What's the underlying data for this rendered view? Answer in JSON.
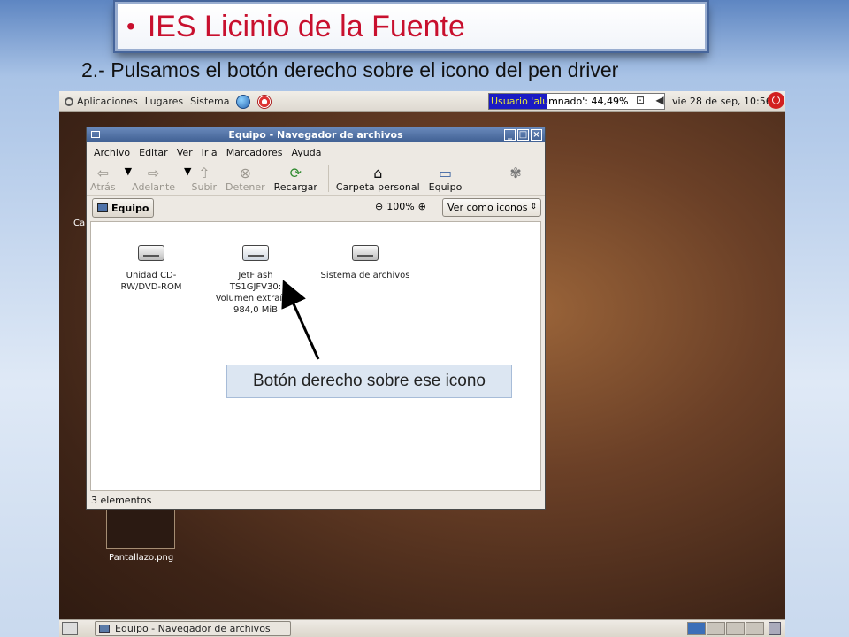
{
  "slide": {
    "title": "IES Licinio de la Fuente",
    "bullet": "•",
    "subtitle": "2.- Pulsamos el botón derecho sobre el icono del pen driver",
    "callout": "Botón derecho sobre ese icono"
  },
  "top_panel": {
    "menus": [
      "Aplicaciones",
      "Lugares",
      "Sistema"
    ],
    "usage_text": "Usuario 'alumnado': 44,49%",
    "usage_fraction": 0.33,
    "clock": "vie 28 de sep, 10:56"
  },
  "desktop": {
    "partial_label": "Ca",
    "thumbnail_label": "Pantallazo.png"
  },
  "window": {
    "title": "Equipo - Navegador de archivos",
    "menubar": [
      "Archivo",
      "Editar",
      "Ver",
      "Ir a",
      "Marcadores",
      "Ayuda"
    ],
    "toolbar": {
      "back": "Atrás",
      "forward": "Adelante",
      "up": "Subir",
      "stop": "Detener",
      "reload": "Recargar",
      "home": "Carpeta personal",
      "computer": "Equipo"
    },
    "location": "Equipo",
    "zoom": "100%",
    "view_mode": "Ver como iconos",
    "items": [
      {
        "label": "Unidad CD-RW/DVD-ROM"
      },
      {
        "label": "JetFlash TS1GJFV30: Volumen extraíble 984,0 MiB"
      },
      {
        "label": "Sistema de archivos"
      }
    ],
    "status": "3 elementos"
  },
  "taskbar": {
    "task": "Equipo - Navegador de archivos"
  },
  "colors": {
    "title_red": "#c8102e",
    "titlebar_blue": "#3f5f92",
    "usage_blue": "#1b1bc4"
  }
}
